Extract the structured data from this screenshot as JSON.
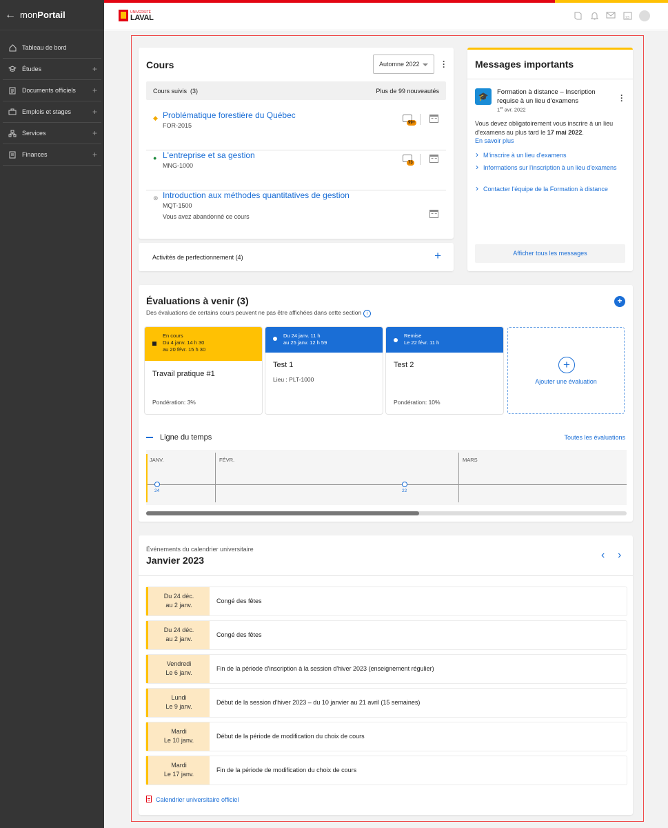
{
  "app": {
    "back_icon": "arrow-left-icon",
    "name_prefix": "mon",
    "name_bold": "Portail"
  },
  "sidebar": {
    "items": [
      {
        "label": "Tableau de bord",
        "icon": "home-icon",
        "expandable": false
      },
      {
        "label": "Études",
        "icon": "graduation-cap-icon",
        "expandable": true
      },
      {
        "label": "Documents officiels",
        "icon": "document-icon",
        "expandable": true
      },
      {
        "label": "Emplois et stages",
        "icon": "briefcase-icon",
        "expandable": true
      },
      {
        "label": "Services",
        "icon": "network-icon",
        "expandable": true
      },
      {
        "label": "Finances",
        "icon": "invoice-icon",
        "expandable": true
      }
    ],
    "plus": "+"
  },
  "header": {
    "logo_small": "UNIVERSITÉ",
    "logo_big": "LAVAL",
    "calendar_day": "23"
  },
  "cours": {
    "title": "Cours",
    "session": "Automne 2022",
    "suivis_label": "Cours suivis",
    "suivis_count": "(3)",
    "news": "Plus de 99 nouveautés",
    "items": [
      {
        "bullet": "◆",
        "bullet_color": "#f2a900",
        "name": "Problématique forestière du Québec",
        "code": "FOR-2015",
        "badge": "99+",
        "note": ""
      },
      {
        "bullet": "●",
        "bullet_color": "#1a8a3a",
        "name": "L'entreprise et sa gestion",
        "code": "MNG-1000",
        "badge": "73",
        "note": ""
      },
      {
        "bullet": "⊗",
        "bullet_color": "#999999",
        "name": "Introduction aux méthodes quantitatives de gestion",
        "code": "MQT-1500",
        "badge": "",
        "note": "Vous avez abandonné ce cours"
      }
    ]
  },
  "activites": {
    "label": "Activités de perfectionnement (4)",
    "plus": "+"
  },
  "messages": {
    "title": "Messages importants",
    "item_title": "Formation à distance – Inscription requise à un lieu d'examens",
    "date_day": "1",
    "date_sup": "er",
    "date_rest": " avr. 2022",
    "body": "Vous devez obligatoirement vous inscrire à un lieu d'examens au plus tard le ",
    "body_bold": "17 mai 2022",
    "body_end": ".",
    "more": "En savoir plus",
    "links": [
      "M'inscrire à un lieu d'examens",
      "Informations sur l'inscription à un lieu d'examens",
      "Contacter l'équipe de la Formation à distance"
    ],
    "all": "Afficher tous les messages"
  },
  "evaluations": {
    "title": "Évaluations à venir (3)",
    "subtitle": "Des évaluations de certains cours peuvent ne pas être affichées dans cette section",
    "cards": [
      {
        "status": "En cours",
        "line1": "Du 4 janv. 14 h 30",
        "line2": "au 20 févr. 15 h 30",
        "title": "Travail pratique #1",
        "sub": "Pondération: 3%",
        "color": "#ffc103"
      },
      {
        "status": "",
        "line1": "Du 24 janv. 11 h",
        "line2": "au 25 janv. 12 h 59",
        "title": "Test 1",
        "sub": "Lieu : PLT-1000",
        "color": "#1a6ed6"
      },
      {
        "status": "Remise",
        "line1": "Le 22 févr. 11 h",
        "line2": "",
        "title": "Test 2",
        "sub": "Pondération: 10%",
        "color": "#1a6ed6"
      }
    ],
    "add": "Ajouter une évaluation",
    "timeline_title": "Ligne du temps",
    "timeline_all": "Toutes les évaluations",
    "months": [
      "JANV.",
      "FÉVR.",
      "MARS"
    ],
    "markers": [
      "24",
      "22"
    ]
  },
  "calendrier": {
    "subtitle": "Événements du calendrier universitaire",
    "title": "Janvier 2023",
    "events": [
      {
        "d1": "Du 24 déc.",
        "d2": "au 2 janv.",
        "text": "Congé des fêtes"
      },
      {
        "d1": "Du 24 déc.",
        "d2": "au 2 janv.",
        "text": "Congé des fêtes"
      },
      {
        "d1": "Vendredi",
        "d2": "Le 6 janv.",
        "text": "Fin de la période d'inscription à la session d'hiver 2023 (enseignement régulier)"
      },
      {
        "d1": "Lundi",
        "d2": "Le 9 janv.",
        "text": "Début de la session d'hiver 2023 – du 10 janvier au 21 avril (15 semaines)"
      },
      {
        "d1": "Mardi",
        "d2": "Le 10 janv.",
        "text": "Début de la période de modification du choix de cours"
      },
      {
        "d1": "Mardi",
        "d2": "Le 17 janv.",
        "text": "Fin de la période de modification du choix de cours"
      }
    ],
    "link": "Calendrier universitaire officiel"
  }
}
